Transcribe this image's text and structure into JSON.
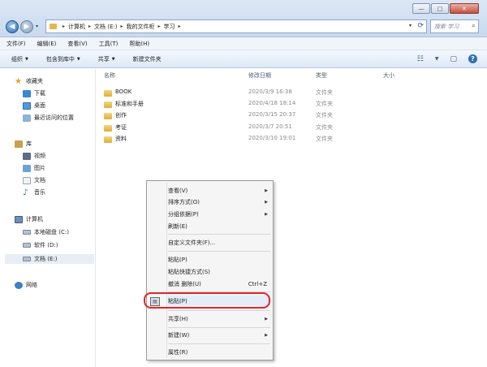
{
  "window": {
    "buttons": {
      "minimize": "—",
      "maximize": "□",
      "close": "✕"
    }
  },
  "address": {
    "crumbs": [
      "计算机",
      "文档 (E:)",
      "我的文件柜",
      "学习"
    ]
  },
  "search": {
    "placeholder": "搜索 学习"
  },
  "menubar": {
    "items": [
      "文件(F)",
      "编辑(E)",
      "查看(V)",
      "工具(T)",
      "帮助(H)"
    ]
  },
  "toolbar": {
    "items": [
      "组织",
      "包含到库中",
      "共享",
      "新建文件夹"
    ]
  },
  "navpane": {
    "favorites": "收藏夹",
    "fav_items": [
      "下载",
      "桌面",
      "最近访问的位置"
    ],
    "libraries": "库",
    "lib_items": [
      "视频",
      "图片",
      "文档",
      "音乐"
    ],
    "computer": "计算机",
    "drives": [
      "本地磁盘 (C:)",
      "软件 (D:)",
      "文档 (E:)"
    ],
    "network": "网络"
  },
  "headers": {
    "name": "名称",
    "date": "修改日期",
    "type": "类型",
    "size": "大小"
  },
  "files": [
    {
      "name": "BOOK",
      "date": "2020/3/9 16:38",
      "type": "文件夹"
    },
    {
      "name": "标准和手册",
      "date": "2020/4/18 18:14",
      "type": "文件夹"
    },
    {
      "name": "创作",
      "date": "2020/3/15 20:37",
      "type": "文件夹"
    },
    {
      "name": "考证",
      "date": "2020/3/7 20:51",
      "type": "文件夹"
    },
    {
      "name": "资料",
      "date": "2020/3/10 19:01",
      "type": "文件夹"
    }
  ],
  "context_menu": {
    "view": "查看(V)",
    "sort": "排序方式(O)",
    "group": "分组依据(P)",
    "refresh": "刷新(E)",
    "customize": "自定义文件夹(F)...",
    "paste": "粘贴(P)",
    "paste_shortcut": "粘贴快捷方式(S)",
    "undo": "撤消 删除(U)",
    "undo_shortcut": "Ctrl+Z",
    "paste2": "粘贴(P)",
    "share": "共享(H)",
    "new": "新建(W)",
    "properties": "属性(R)"
  },
  "colors": {
    "highlight_ring": "#e0262a",
    "accent": "#2f6fb5"
  }
}
